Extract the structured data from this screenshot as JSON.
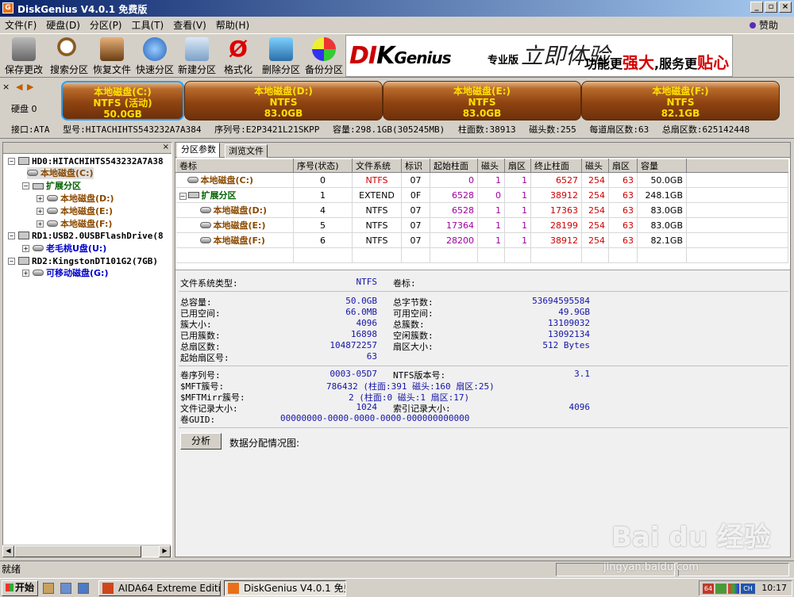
{
  "window": {
    "title": "DiskGenius V4.0.1 免费版"
  },
  "menu": {
    "items": [
      "文件(F)",
      "硬盘(D)",
      "分区(P)",
      "工具(T)",
      "查看(V)",
      "帮助(H)"
    ],
    "donate": "赞助"
  },
  "toolbar": {
    "buttons": [
      "保存更改",
      "搜索分区",
      "恢复文件",
      "快速分区",
      "新建分区",
      "格式化",
      "删除分区",
      "备份分区"
    ],
    "banner": {
      "brand_a": "DI",
      "brand_b": "K",
      "brand_c": "Genius",
      "edition": "专业版",
      "brush": "立即体验",
      "slogan_a": "功能更",
      "slogan_b": "强大",
      "slogan_c": ",服务更",
      "slogan_d": "贴心"
    }
  },
  "diskbar": {
    "disk_label": "硬盘 0",
    "partitions": [
      {
        "name": "本地磁盘(C:)",
        "fs": "NTFS (活动)",
        "size": "50.0GB"
      },
      {
        "name": "本地磁盘(D:)",
        "fs": "NTFS",
        "size": "83.0GB"
      },
      {
        "name": "本地磁盘(E:)",
        "fs": "NTFS",
        "size": "83.0GB"
      },
      {
        "name": "本地磁盘(F:)",
        "fs": "NTFS",
        "size": "82.1GB"
      }
    ],
    "info": {
      "interface": "接口:ATA",
      "model": "型号:HITACHIHTS543232A7A384",
      "serial": "序列号:E2P3421L21SKPP",
      "capacity": "容量:298.1GB(305245MB)",
      "cylinders": "柱面数:38913",
      "heads": "磁头数:255",
      "sectors_per_track": "每道扇区数:63",
      "total_sectors": "总扇区数:625142448"
    }
  },
  "tree": {
    "nodes": [
      {
        "label": "HD0:HITACHIHTS543232A7A38",
        "kind": "disk"
      },
      {
        "label": "本地磁盘(C:)",
        "kind": "part"
      },
      {
        "label": "扩展分区",
        "kind": "ext"
      },
      {
        "label": "本地磁盘(D:)",
        "kind": "part"
      },
      {
        "label": "本地磁盘(E:)",
        "kind": "part"
      },
      {
        "label": "本地磁盘(F:)",
        "kind": "part"
      },
      {
        "label": "RD1:USB2.0USBFlashDrive(8",
        "kind": "disk"
      },
      {
        "label": "老毛桃U盘(U:)",
        "kind": "blue"
      },
      {
        "label": "RD2:KingstonDT101G2(7GB)",
        "kind": "disk"
      },
      {
        "label": "可移动磁盘(G:)",
        "kind": "blue"
      }
    ]
  },
  "tabs": [
    "分区参数",
    "浏览文件"
  ],
  "table": {
    "headers": [
      "卷标",
      "序号(状态)",
      "文件系统",
      "标识",
      "起始柱面",
      "磁头",
      "扇区",
      "终止柱面",
      "磁头",
      "扇区",
      "容量"
    ],
    "rows": [
      {
        "label": "本地磁盘(C:)",
        "idx": "0",
        "fs": "NTFS",
        "id": "07",
        "sc": "0",
        "sh": "1",
        "ss": "1",
        "ec": "6527",
        "eh": "254",
        "es": "63",
        "cap": "50.0GB"
      },
      {
        "label": "扩展分区",
        "idx": "1",
        "fs": "EXTEND",
        "id": "0F",
        "sc": "6528",
        "sh": "0",
        "ss": "1",
        "ec": "38912",
        "eh": "254",
        "es": "63",
        "cap": "248.1GB"
      },
      {
        "label": "本地磁盘(D:)",
        "idx": "4",
        "fs": "NTFS",
        "id": "07",
        "sc": "6528",
        "sh": "1",
        "ss": "1",
        "ec": "17363",
        "eh": "254",
        "es": "63",
        "cap": "83.0GB"
      },
      {
        "label": "本地磁盘(E:)",
        "idx": "5",
        "fs": "NTFS",
        "id": "07",
        "sc": "17364",
        "sh": "1",
        "ss": "1",
        "ec": "28199",
        "eh": "254",
        "es": "63",
        "cap": "83.0GB"
      },
      {
        "label": "本地磁盘(F:)",
        "idx": "6",
        "fs": "NTFS",
        "id": "07",
        "sc": "28200",
        "sh": "1",
        "ss": "1",
        "ec": "38912",
        "eh": "254",
        "es": "63",
        "cap": "82.1GB"
      }
    ]
  },
  "fsinfo": {
    "fs_type_label": "文件系统类型:",
    "fs_type": "NTFS",
    "volume_label_label": "卷标:",
    "total_label": "总容量:",
    "total": "50.0GB",
    "used_label": "已用空间:",
    "used": "66.0MB",
    "cluster_label": "簇大小:",
    "cluster": "4096",
    "used_clusters_label": "已用簇数:",
    "used_clusters": "16898",
    "total_sectors_label": "总扇区数:",
    "total_sectors": "104872257",
    "start_sector_label": "起始扇区号:",
    "start_sector": "63",
    "total_bytes_label": "总字节数:",
    "total_bytes": "53694595584",
    "free_label": "可用空间:",
    "free": "49.9GB",
    "total_clusters_label": "总簇数:",
    "total_clusters": "13109032",
    "free_clusters_label": "空闲簇数:",
    "free_clusters": "13092134",
    "sector_size_label": "扇区大小:",
    "sector_size": "512 Bytes",
    "serial_label": "卷序列号:",
    "serial": "0003-05D7",
    "ntfs_ver_label": "NTFS版本号:",
    "ntfs_ver": "3.1",
    "mft_label": "$MFT簇号:",
    "mft": "786432 (柱面:391 磁头:160 扇区:25)",
    "mftmirr_label": "$MFTMirr簇号:",
    "mftmirr": "2 (柱面:0 磁头:1 扇区:17)",
    "record_label": "文件记录大小:",
    "record": "1024",
    "index_label": "索引记录大小:",
    "index": "4096",
    "guid_label": "卷GUID:",
    "guid": "00000000-0000-0000-0000-000000000000",
    "analyze": "分析",
    "alloc_map": "数据分配情况图:"
  },
  "status": {
    "text": "就绪"
  },
  "taskbar": {
    "start": "开始",
    "tasks": [
      "AIDA64 Extreme Edition",
      "DiskGenius V4.0.1 免费版"
    ],
    "clock": "10:17",
    "ime": "CH"
  },
  "watermark": {
    "logo": "Bai du 经验",
    "url": "jingyan.baidu.com"
  }
}
